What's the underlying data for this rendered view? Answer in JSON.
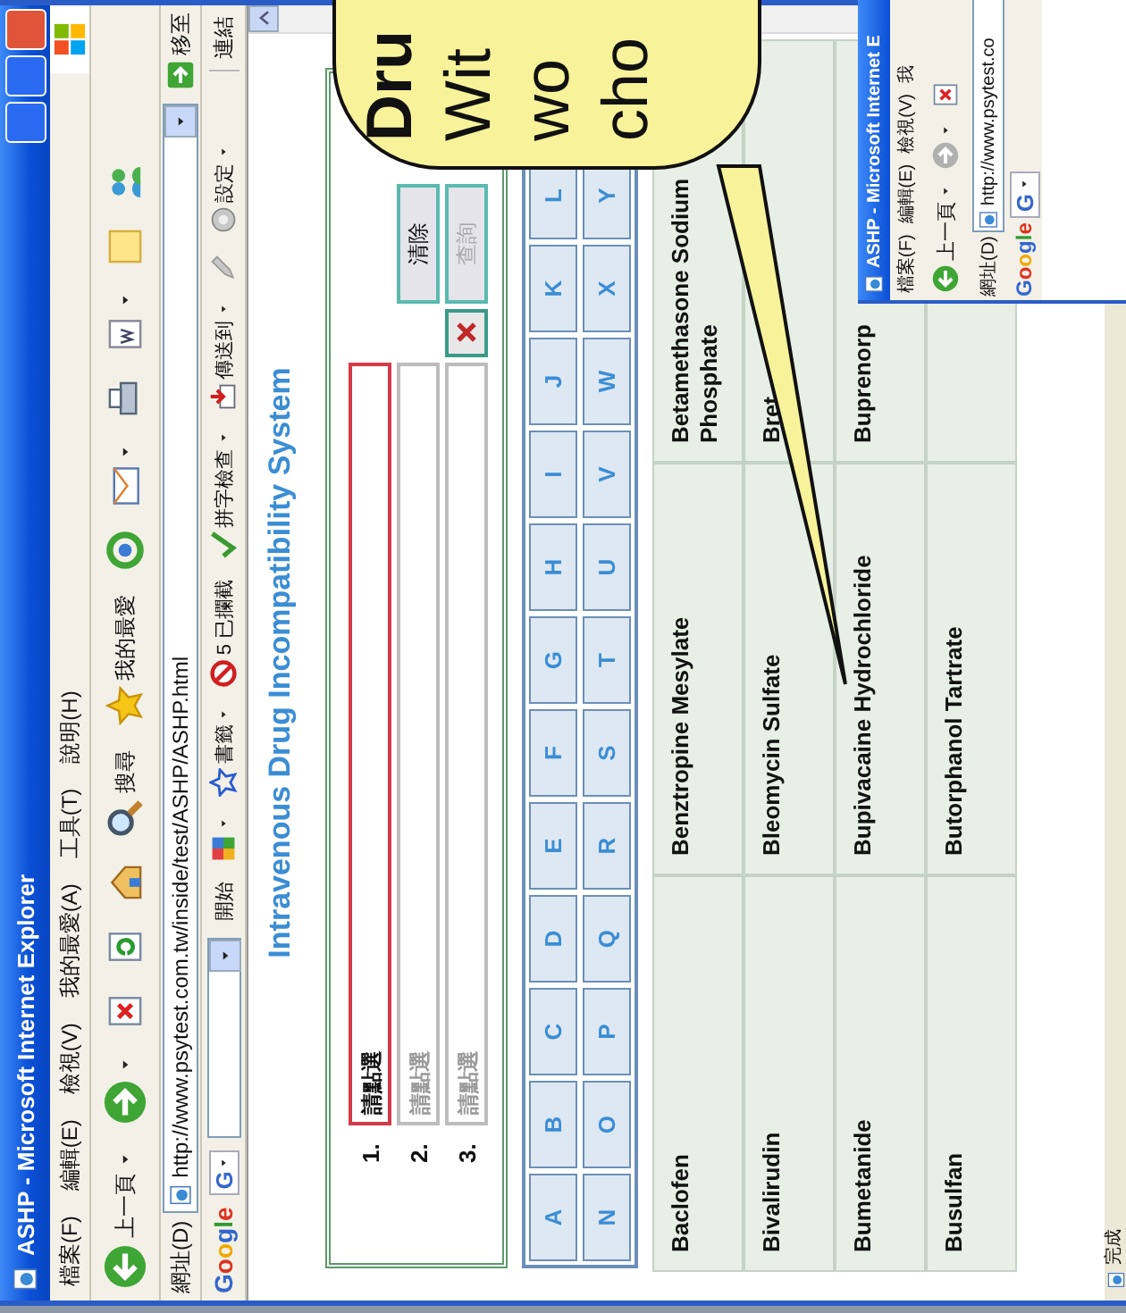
{
  "window": {
    "title": "ASHP - Microsoft Internet Explorer"
  },
  "menu": [
    "檔案(F)",
    "編輯(E)",
    "檢視(V)",
    "我的最愛(A)",
    "工具(T)",
    "說明(H)"
  ],
  "toolbar": [
    {
      "kind": "back",
      "label": "上一頁",
      "caret": true
    },
    {
      "kind": "forward",
      "caret": true
    },
    {
      "kind": "stop"
    },
    {
      "kind": "refresh"
    },
    {
      "kind": "home"
    },
    {
      "kind": "search",
      "label": "搜尋"
    },
    {
      "kind": "favorites",
      "label": "我的最愛"
    },
    {
      "kind": "history"
    },
    {
      "kind": "mail",
      "caret": true
    },
    {
      "kind": "print"
    },
    {
      "kind": "word",
      "caret": true
    },
    {
      "kind": "note"
    },
    {
      "kind": "messenger"
    }
  ],
  "address_bar": {
    "label": "網址(D)",
    "url": "http://www.psytest.com.tw/inside/test/ASHP/ASHP.html",
    "go": "移至"
  },
  "google_bar": {
    "logo": "Google",
    "search_button": "G",
    "items": [
      {
        "kind": "start",
        "label": "開始"
      },
      {
        "kind": "puzzle",
        "caret": true
      },
      {
        "kind": "bookmarks",
        "label": "書籤",
        "caret": true
      },
      {
        "kind": "blocked",
        "label": "5 已攔截"
      },
      {
        "kind": "spell",
        "label": "拼字檢查",
        "caret": true
      },
      {
        "kind": "sendto",
        "label": "傳送到",
        "caret": true
      },
      {
        "kind": "pen"
      },
      {
        "kind": "settings",
        "label": "設定",
        "caret": true
      }
    ],
    "links": "連結"
  },
  "page": {
    "title": "Intravenous Drug Incompatibility System",
    "selections": [
      {
        "number": "1.",
        "placeholder": "請點選",
        "selected": true,
        "removable": false
      },
      {
        "number": "2.",
        "placeholder": "請點選",
        "selected": false,
        "removable": false
      },
      {
        "number": "3.",
        "placeholder": "請點選",
        "selected": false,
        "removable": true
      }
    ],
    "buttons": [
      {
        "label": "清除",
        "disabled": false
      },
      {
        "label": "查詢",
        "disabled": true
      }
    ],
    "letters": [
      [
        "A",
        "B",
        "C",
        "D",
        "E",
        "F",
        "G",
        "H",
        "I",
        "J",
        "K",
        "L"
      ],
      [
        "N",
        "O",
        "P",
        "Q",
        "R",
        "S",
        "T",
        "U",
        "V",
        "W",
        "X",
        "Y"
      ]
    ],
    "drugs": [
      [
        "Baclofen",
        "Benztropine Mesylate",
        "Betamethasone Sodium Phosphate"
      ],
      [
        "Bivalirudin",
        "Bleomycin Sulfate",
        "Bret"
      ],
      [
        "Bumetanide",
        "Bupivacaine Hydrochloride",
        "Buprenorp"
      ],
      [
        "Busulfan",
        "Butorphanol Tartrate"
      ]
    ]
  },
  "status_bar": {
    "text": "完成"
  },
  "callout": {
    "lines": [
      {
        "text": "Dru",
        "bold": true
      },
      {
        "text": "Wit",
        "bold": false
      },
      {
        "text": "wo",
        "bold": false
      },
      {
        "text": "cho",
        "bold": false
      }
    ]
  },
  "inner_window": {
    "title": "ASHP - Microsoft Internet E",
    "menu": [
      "檔案(F)",
      "編輯(E)",
      "檢視(V)",
      "我"
    ],
    "toolbar": [
      {
        "kind": "back",
        "label": "上一頁",
        "caret": true
      },
      {
        "kind": "forward",
        "disabled": true,
        "caret": true
      },
      {
        "kind": "stop"
      }
    ],
    "address_label": "網址(D)",
    "url": "http://www.psytest.co",
    "logo": "Google",
    "search_button": "G"
  }
}
